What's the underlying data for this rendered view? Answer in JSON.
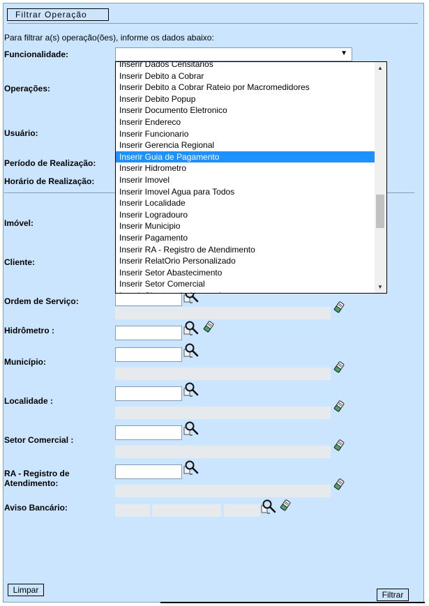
{
  "panel": {
    "title": "Filtrar Operação"
  },
  "intro": "Para filtrar a(s) operação(ões), informe os dados abaixo:",
  "labels": {
    "funcionalidade": "Funcionalidade:",
    "operacoes": "Operações:",
    "usuario": "Usuário:",
    "periodo": "Período de Realização:",
    "horario": "Horário de Realização:",
    "imovel": "Imóvel:",
    "cliente": "Cliente:",
    "ordem_servico": "Ordem de Serviço:",
    "hidrometro": "Hidrômetro :",
    "municipio": "Município:",
    "localidade": "Localidade :",
    "setor_comercial": "Setor Comercial :",
    "ra_line1": "RA - Registro de",
    "ra_line2": "Atendimento:",
    "aviso_bancario": "Aviso Bancário:"
  },
  "funcionalidade_select": {
    "value": "",
    "arrow": "▼",
    "options": [
      "Inserir Dados Censitarios",
      "Inserir Debito a Cobrar",
      "Inserir Debito a Cobrar Rateio por Macromedidores",
      "Inserir Debito Popup",
      "Inserir Documento Eletronico",
      "Inserir Endereco",
      "Inserir Funcionario",
      "Inserir Gerencia Regional",
      "Inserir Guia de Pagamento",
      "Inserir Hidrometro",
      "Inserir Imovel",
      "Inserir Imovel Agua para Todos",
      "Inserir Localidade",
      "Inserir Logradouro",
      "Inserir Municipio",
      "Inserir Pagamento",
      "Inserir RA - Registro de Atendimento",
      "Inserir RelatOrio Personalizado",
      "Inserir Setor Abastecimento",
      "Inserir Setor Comercial",
      "Inserir Sistema de Abastecimento"
    ],
    "highlighted": "Inserir Guia de Pagamento"
  },
  "buttons": {
    "limpar": "Limpar",
    "filtrar": "Filtrar"
  },
  "icons": {
    "search": "magnifier-icon",
    "clear": "eraser-icon"
  },
  "colors": {
    "panel_bg": "#cbe5fe",
    "highlight": "#1e90ff",
    "readonly_field": "#e6eaed"
  }
}
